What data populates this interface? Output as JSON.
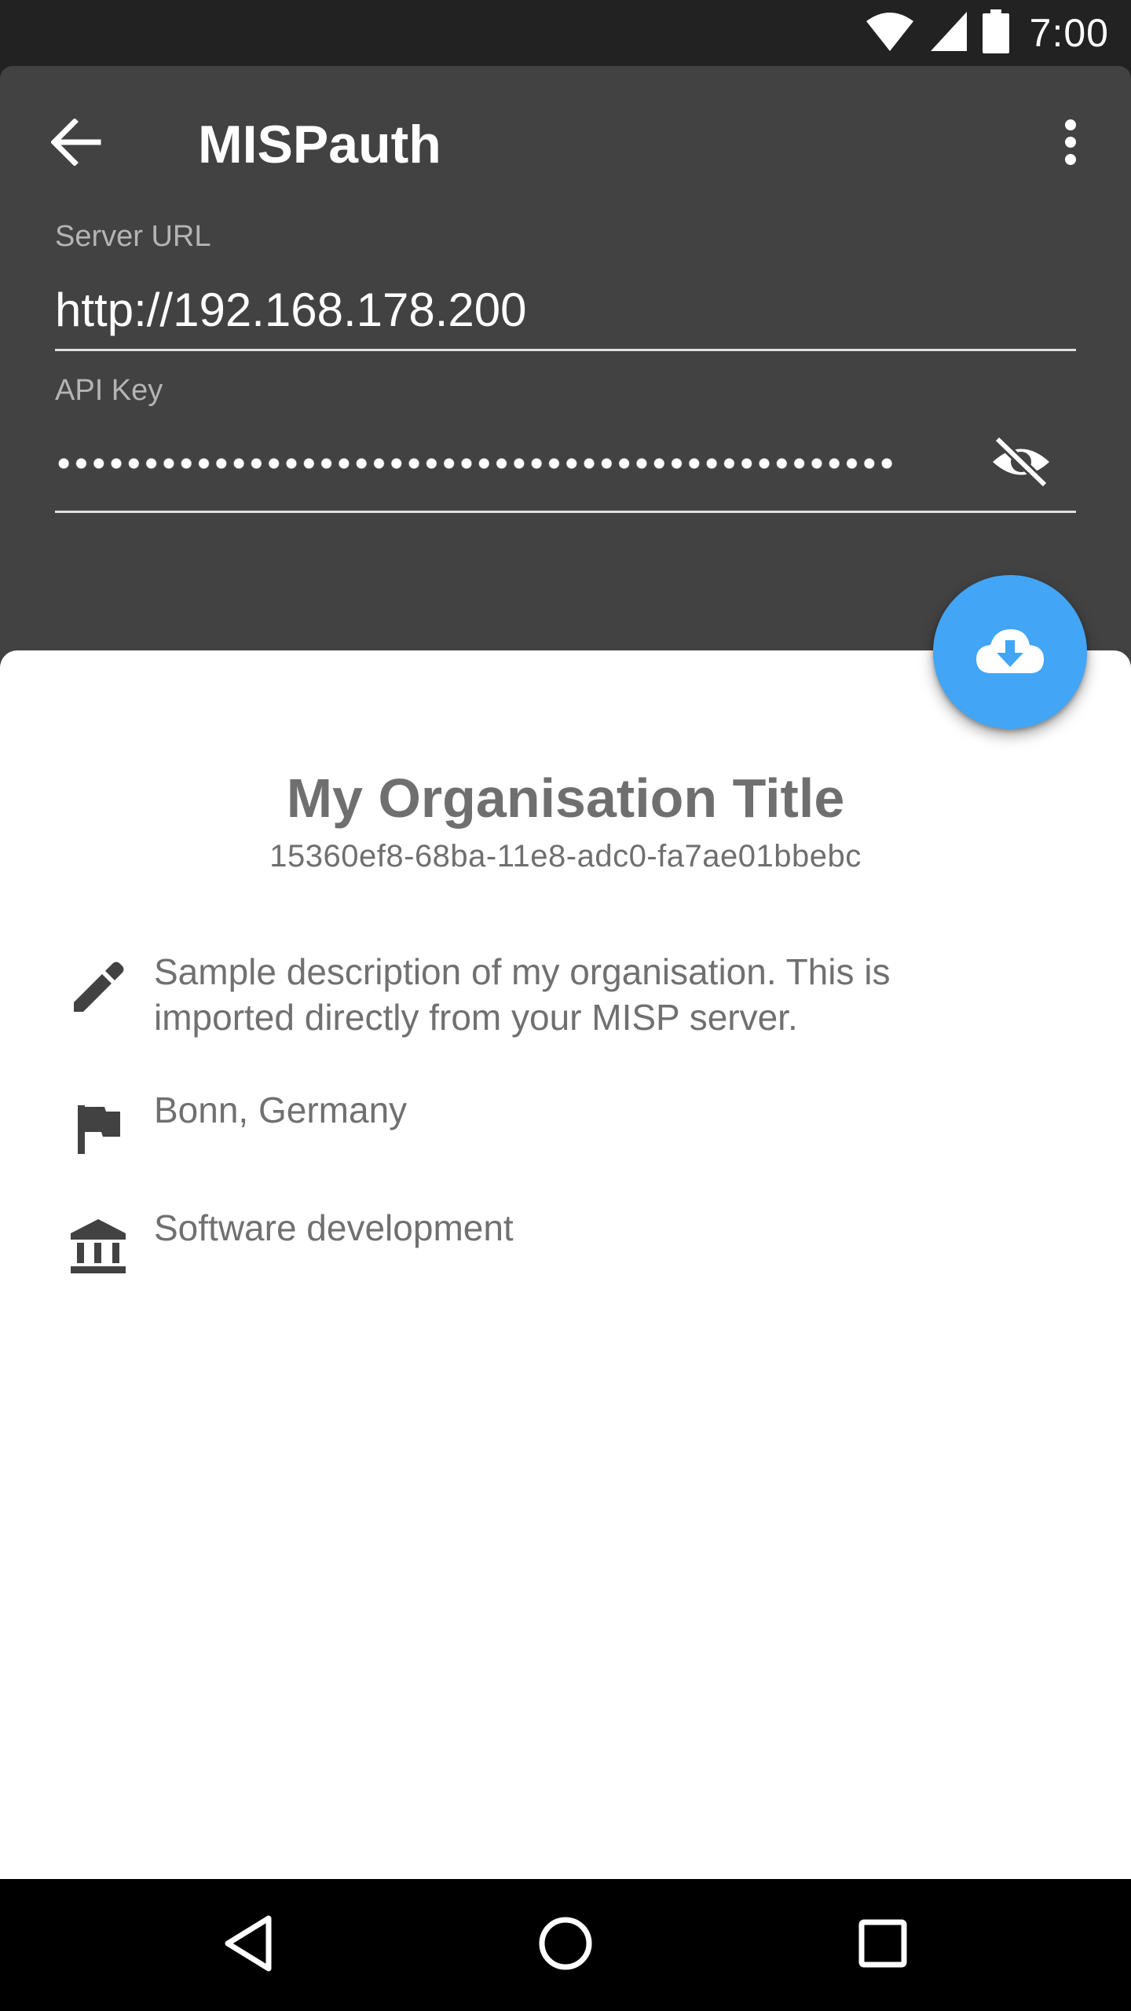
{
  "status_bar": {
    "time": "7:00",
    "icons": [
      "wifi-icon",
      "cellular-signal-icon",
      "battery-icon"
    ]
  },
  "toolbar": {
    "title": "MISPauth",
    "back_icon": "arrow-back-icon",
    "menu_icon": "more-vert-icon"
  },
  "form": {
    "server_url_label": "Server URL",
    "server_url_value": "http://192.168.178.200",
    "api_key_label": "API Key",
    "api_key_masked": "●●●●●●●●●●●●●●●●●●●●●●●●●●●●●●●●●●●●●●●●●●●●●●●●",
    "visibility_icon": "visibility-off-icon"
  },
  "fab": {
    "icon": "cloud-download-icon"
  },
  "organisation": {
    "title": "My Organisation Title",
    "uuid": "15360ef8-68ba-11e8-adc0-fa7ae01bbebc",
    "description": "Sample description of my organisation. This is imported directly from your MISP server.",
    "location": "Bonn, Germany",
    "sector": "Software development"
  },
  "colors": {
    "header_bg": "#424242",
    "accent": "#42a5f5",
    "sheet_bg": "#ffffff",
    "text_secondary": "#707070"
  },
  "nav_bar": {
    "icons": [
      "nav-back-icon",
      "nav-home-icon",
      "nav-recents-icon"
    ]
  }
}
